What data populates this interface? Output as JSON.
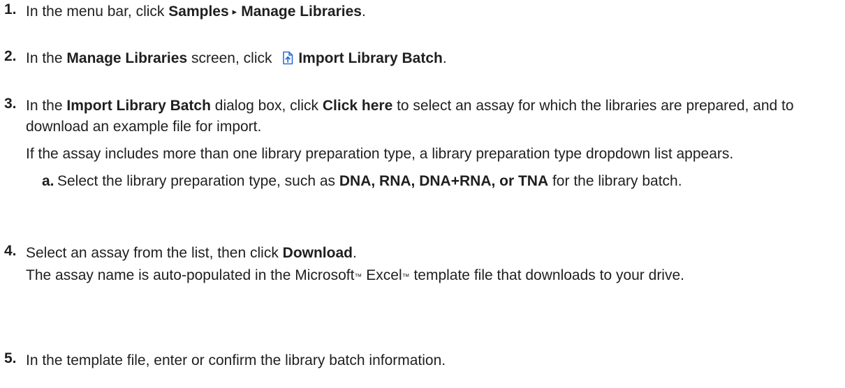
{
  "steps": [
    {
      "number": "1.",
      "text_1": "In the menu bar, click ",
      "bold_1": "Samples",
      "separator_glyph": "▸",
      "bold_2": "Manage Libraries",
      "text_2": "."
    },
    {
      "number": "2.",
      "text_1": "In the ",
      "bold_1": "Manage Libraries",
      "text_2": " screen, click ",
      "icon": "import-file-icon",
      "bold_2": "Import Library Batch",
      "text_3": "."
    },
    {
      "number": "3.",
      "text_1": "In the ",
      "bold_1": "Import Library Batch",
      "text_2": " dialog box, click ",
      "bold_2": "Click here",
      "text_3": " to select an assay for which the libraries are prepared, and to download an example file for import.",
      "note": "If the assay includes more than one library preparation type, a library preparation type dropdown list appears.",
      "substep": {
        "letter": "a.",
        "text_1": "Select the library preparation type, such as ",
        "bold_1": "DNA, RNA, DNA+RNA, or TNA",
        "text_2": " for the library batch."
      }
    },
    {
      "number": "4.",
      "text_1": "Select an assay from the list, then click ",
      "bold_1": "Download",
      "text_2": ".",
      "note_1": "The assay name is auto-populated in the Microsoft",
      "tm_1": "™",
      "note_2": " Excel",
      "tm_2": "™",
      "note_3": " template file that downloads to your drive."
    },
    {
      "number": "5.",
      "text_1": "In the template file, enter or confirm the library batch information."
    }
  ],
  "colors": {
    "text": "#1f1f1f",
    "icon": "#2f6fd6"
  }
}
